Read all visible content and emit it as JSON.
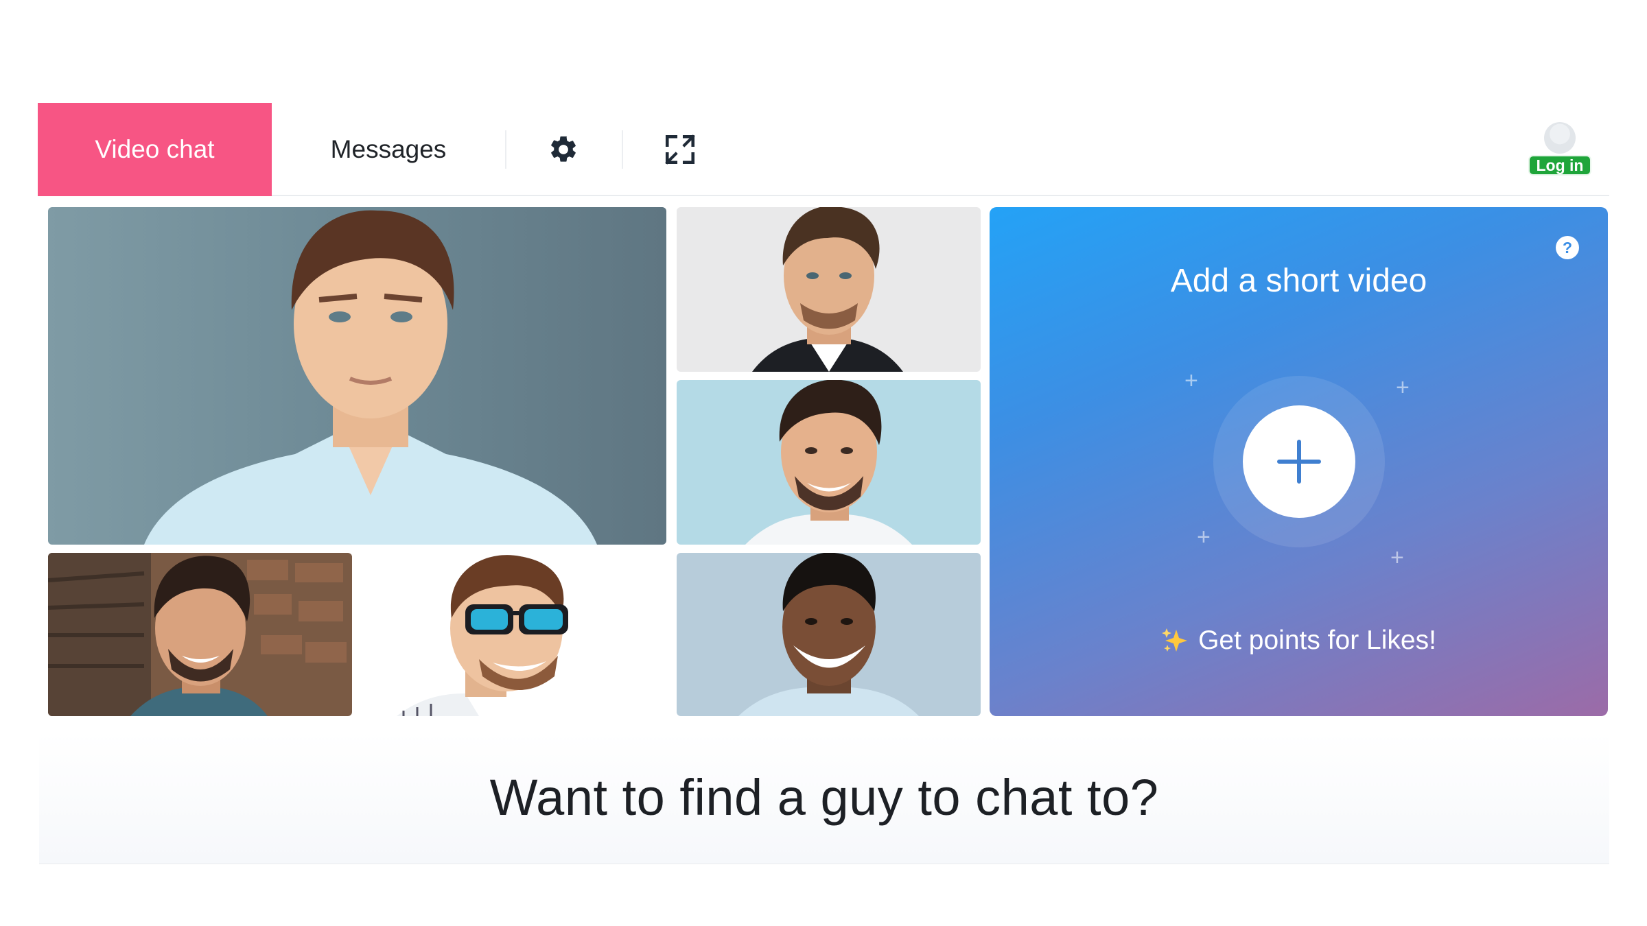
{
  "nav": {
    "video_chat_label": "Video chat",
    "messages_label": "Messages",
    "settings_icon": "gear-icon",
    "fullscreen_icon": "expand-icon",
    "login_label": "Log in",
    "accent_color": "#f75584"
  },
  "promo": {
    "title": "Add a short video",
    "help_label": "?",
    "footer_emoji": "sparkles-icon",
    "footer_text": "Get points for Likes!",
    "gradient": [
      "#24a2f6",
      "#9c6ba7"
    ]
  },
  "main": {
    "headline": "Want to find a guy to chat to?"
  },
  "photos": [
    {
      "name": "profile-photo-large"
    },
    {
      "name": "profile-photo-top"
    },
    {
      "name": "profile-photo-middle"
    },
    {
      "name": "profile-photo-bottom-left"
    },
    {
      "name": "profile-photo-sunglasses"
    },
    {
      "name": "profile-photo-bottom-right"
    }
  ]
}
